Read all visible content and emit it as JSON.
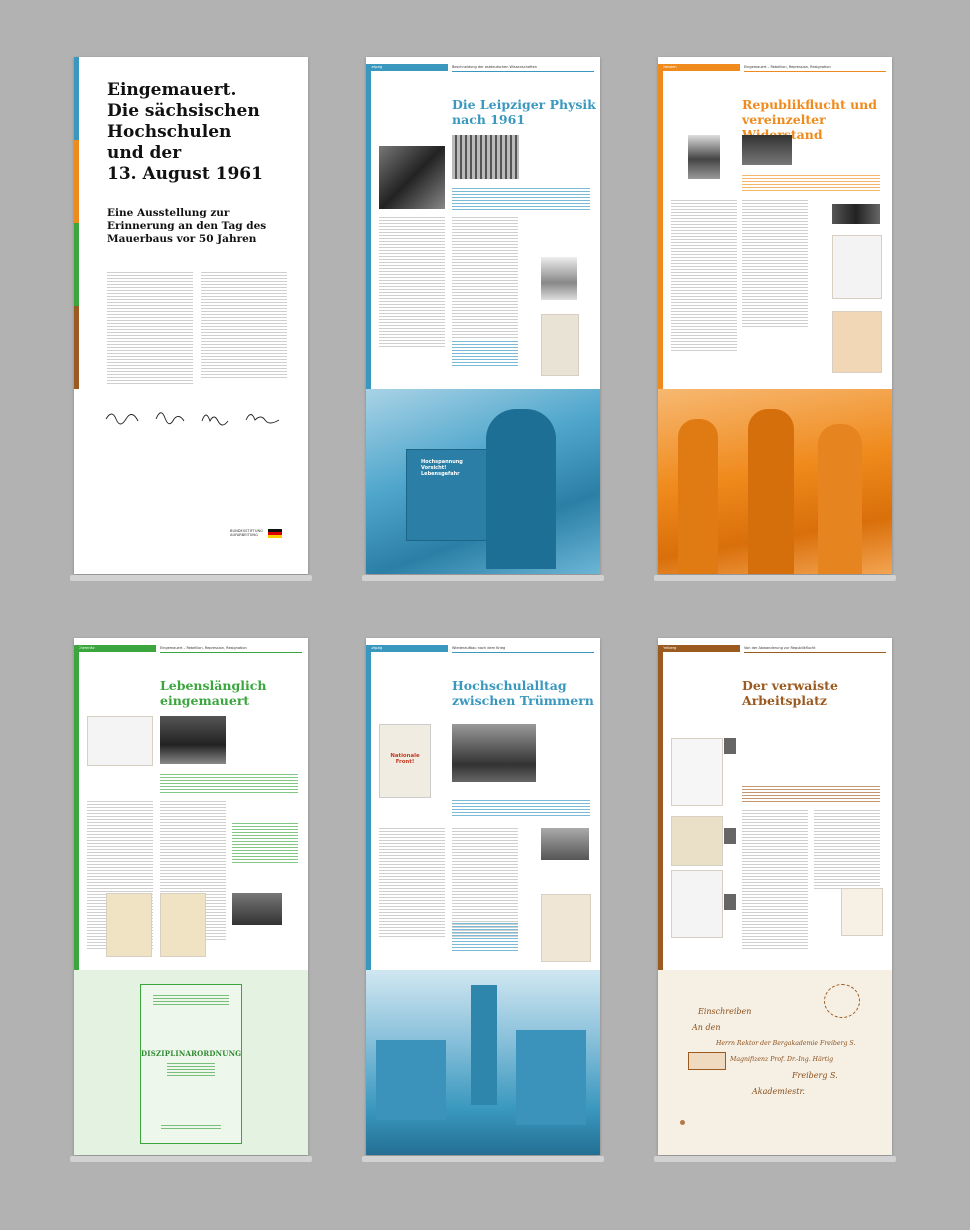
{
  "panel1": {
    "title_lines": [
      "Eingemauert.",
      "Die sächsischen",
      "Hochschulen",
      "und der",
      "13. August 1961"
    ],
    "subtitle_lines": [
      "Eine Ausstellung zur",
      "Erinnerung an den Tag des",
      "Mauerbaus vor 50 Jahren"
    ],
    "logo_line1": "BUNDESSTIFTUNG",
    "logo_line2": "AUFARBEITUNG"
  },
  "panel2": {
    "location": "Leipzig",
    "section": "Beschneidung der ostdeutschen Wissenschaften",
    "title_lines": [
      "Die Leipziger Physik",
      "nach 1961"
    ],
    "machine_label": "Hochspannung Vorsicht! Lebensgefahr",
    "accent": "#3a98bf"
  },
  "panel3": {
    "location": "Dresden",
    "section": "Eingemauert – Rebellion, Repression, Resignation",
    "title_lines": [
      "Republikflucht und",
      "vereinzelter Widerstand"
    ],
    "accent": "#ef8a1c"
  },
  "panel4": {
    "location": "Chemnitz",
    "section": "Eingemauert – Rebellion, Repression, Resignation",
    "title_lines": [
      "Lebenslänglich",
      "eingemauert"
    ],
    "doc_title": "DISZIPLINARORDNUNG",
    "accent": "#3ba63d"
  },
  "panel5": {
    "location": "Leipzig",
    "section": "Wiederaufbau nach dem Krieg",
    "title_lines": [
      "Hochschulalltag",
      "zwischen Trümmern"
    ],
    "poster_text": "Nationale Front!",
    "accent": "#3a98bf"
  },
  "panel6": {
    "location": "Freiberg",
    "section": "Von der Abwanderung zur Republikflucht",
    "title_lines": [
      "Der verwaiste",
      "Arbeitsplatz"
    ],
    "letter_lines": [
      "Einschreiben",
      "An den",
      "Herrn Rektor der Bergakademie Freiberg S.",
      "Magnifizenz Prof. Dr.-Ing. Härtig",
      "Freiberg S.",
      "Akademiestr."
    ],
    "accent": "#9b5a1f"
  }
}
